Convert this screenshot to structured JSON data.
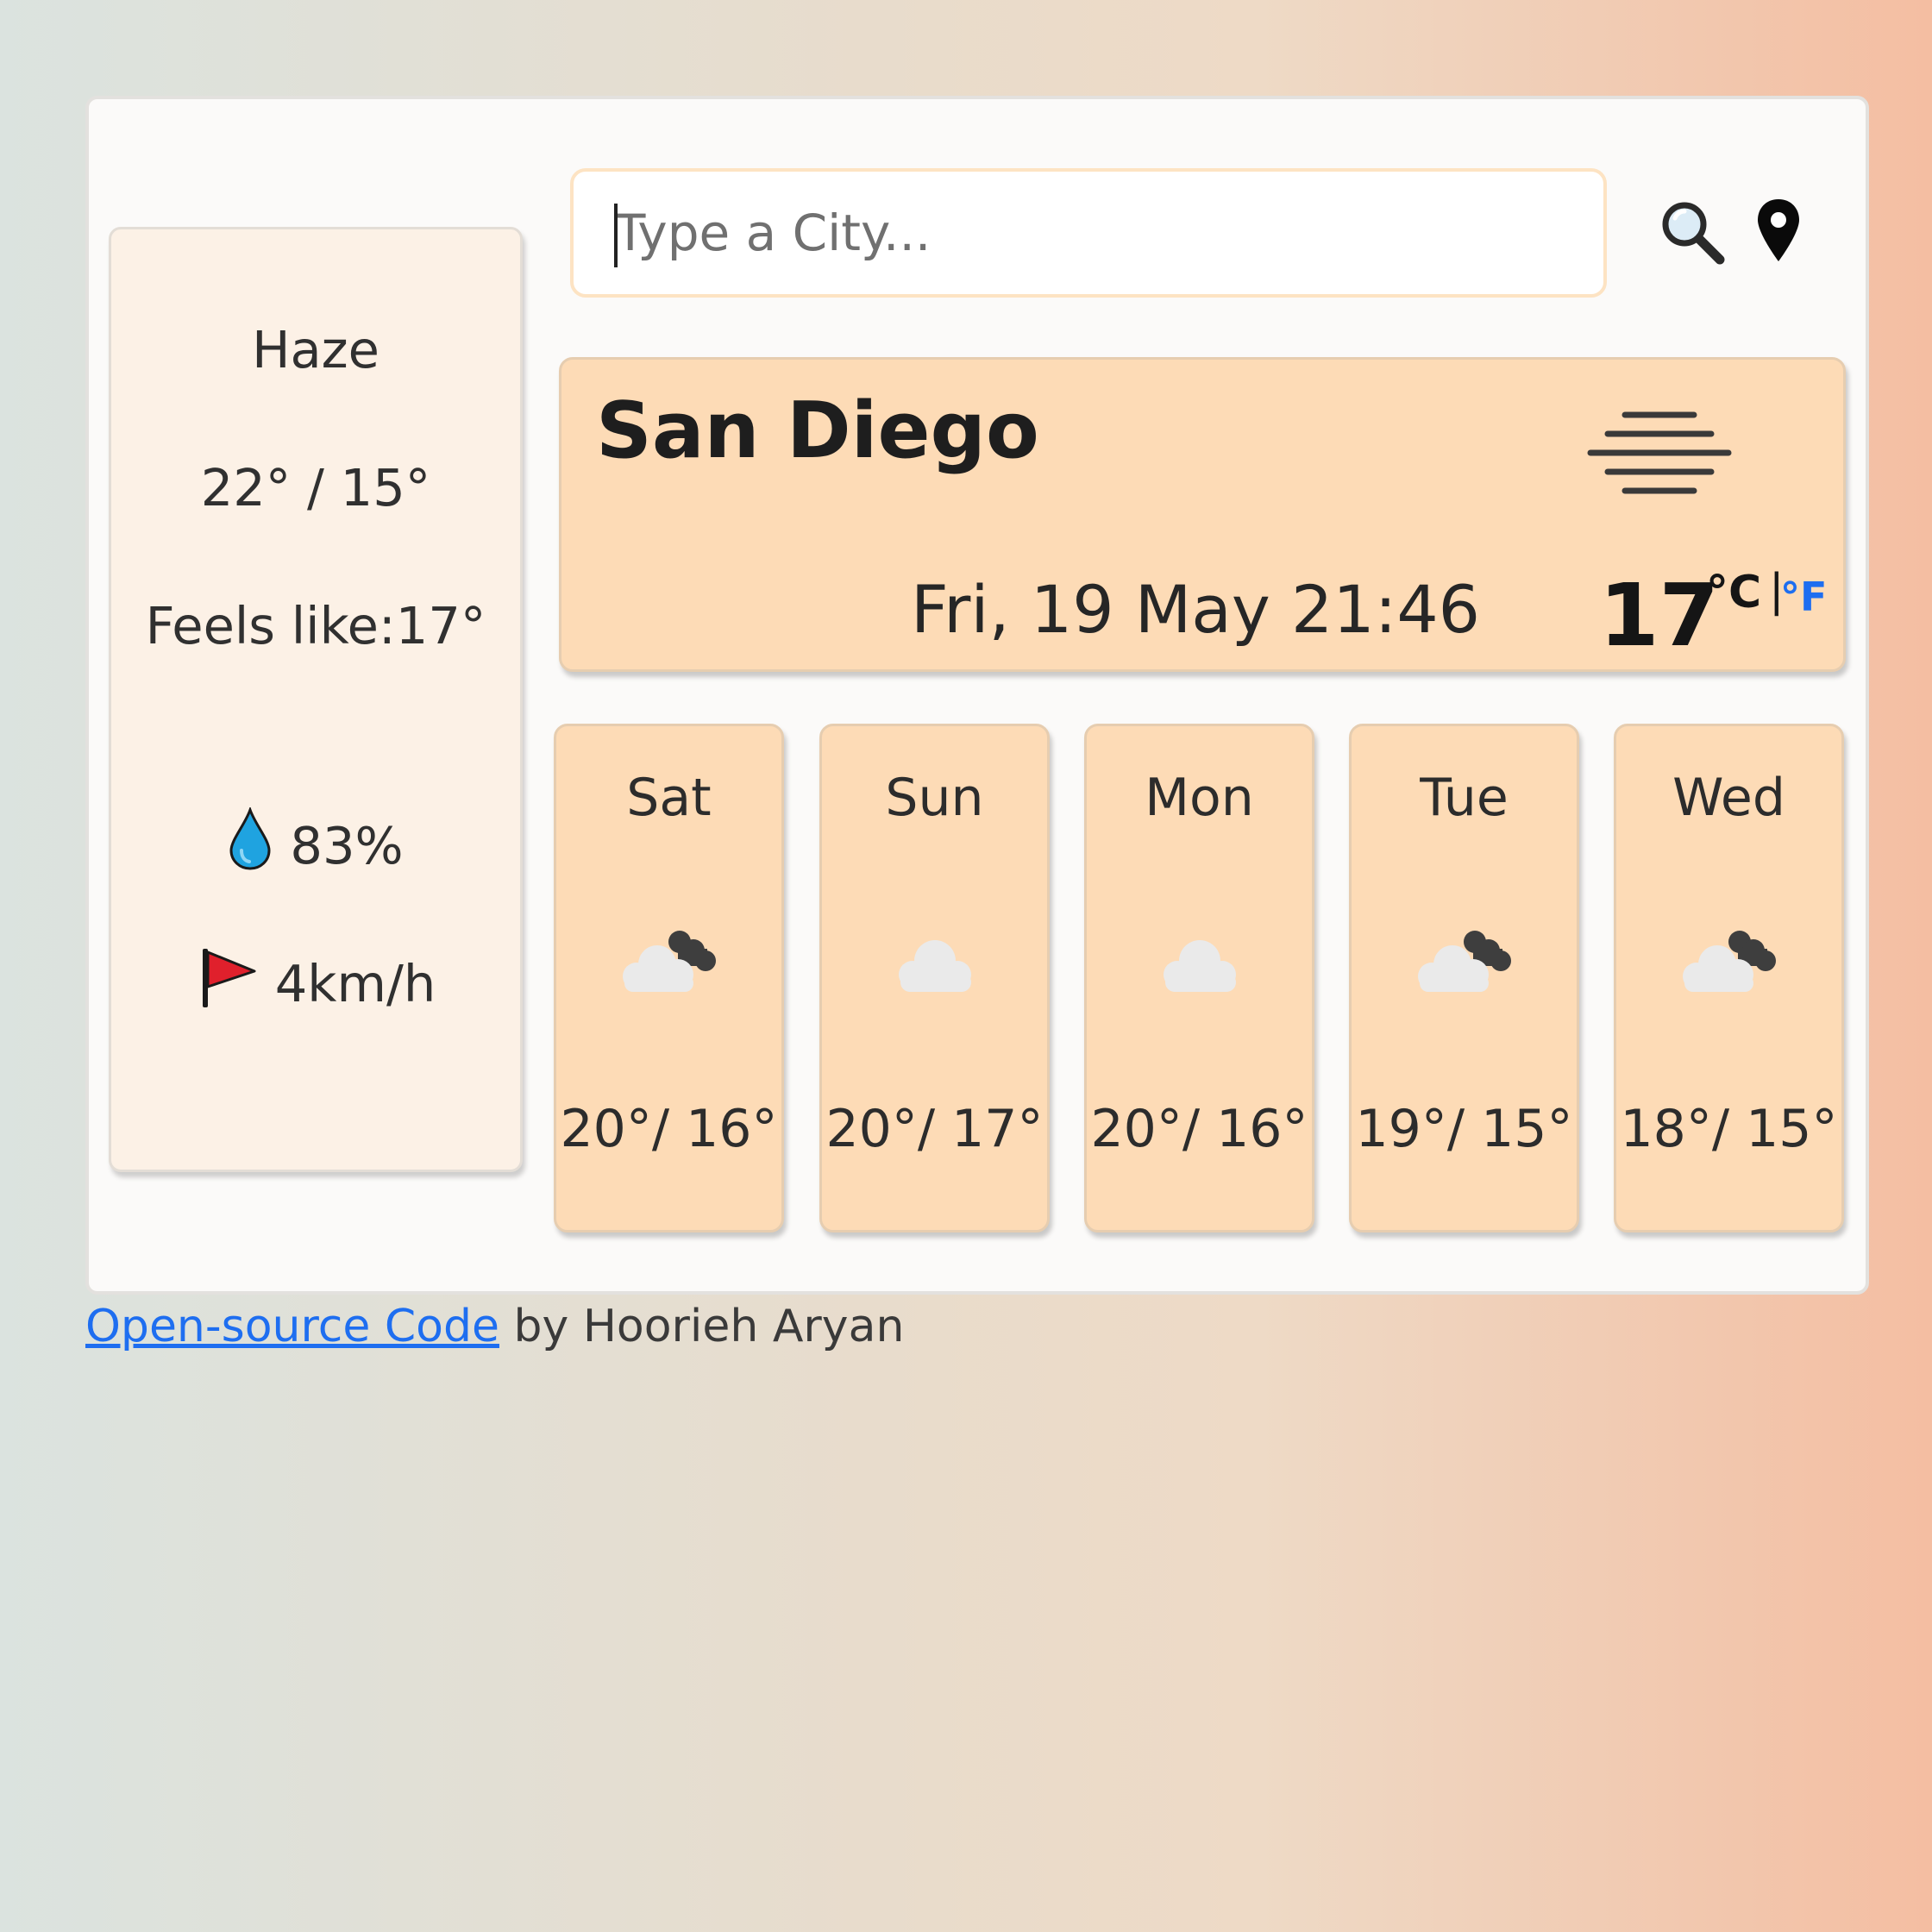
{
  "search": {
    "placeholder": "Type a City..."
  },
  "summary": {
    "condition": "Haze",
    "high_low": "22° / 15°",
    "feels_like": "Feels like:17°",
    "humidity": "83%",
    "wind": "4km/h"
  },
  "current": {
    "city": "San Diego",
    "datetime": "Fri, 19 May 21:46",
    "temperature": "17",
    "unit_celsius": "°C",
    "unit_separator": "|",
    "unit_fahrenheit": "°F",
    "condition_icon": "haze-icon"
  },
  "forecast": [
    {
      "day": "Sat",
      "temps": "20°/ 16°",
      "icon": "broken-clouds-icon"
    },
    {
      "day": "Sun",
      "temps": "20°/ 17°",
      "icon": "cloud-icon"
    },
    {
      "day": "Mon",
      "temps": "20°/ 16°",
      "icon": "cloud-icon"
    },
    {
      "day": "Tue",
      "temps": "19°/ 15°",
      "icon": "broken-clouds-icon"
    },
    {
      "day": "Wed",
      "temps": "18°/ 15°",
      "icon": "broken-clouds-icon"
    }
  ],
  "footer": {
    "link_text": "Open-source Code",
    "suffix": " by Hoorieh Aryan"
  },
  "colors": {
    "card": "#fddbb6",
    "side_panel": "#fcf1e6",
    "link": "#1e6ef0",
    "drop": "#1fa3e0",
    "flag": "#e0202c"
  }
}
